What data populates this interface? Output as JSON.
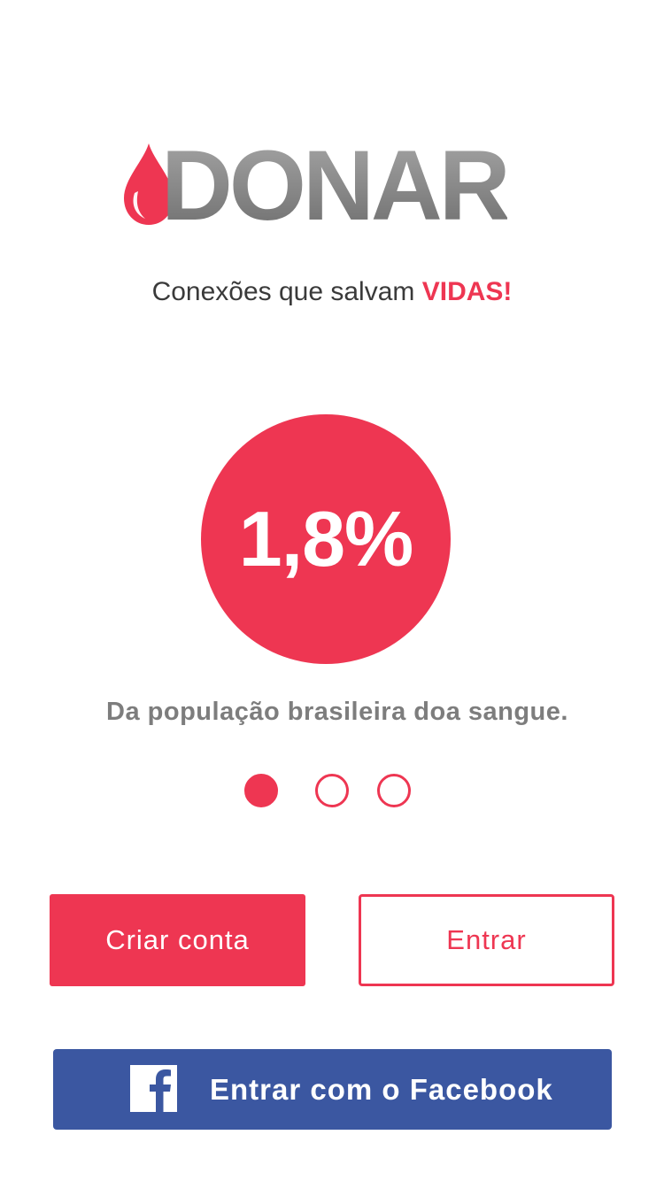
{
  "brand": {
    "name": "DONAR",
    "tagline_prefix": "Conexões que salvam ",
    "tagline_accent": "VIDAS!",
    "accent_color": "#ee3652",
    "facebook_color": "#3b57a1"
  },
  "onboarding": {
    "stat_value": "1,8%",
    "stat_caption": "Da população brasileira doa sangue.",
    "pages_total": 3,
    "active_page": 1
  },
  "actions": {
    "create_account_label": "Criar conta",
    "login_label": "Entrar",
    "facebook_label": "Entrar com o Facebook"
  },
  "icons": {
    "logo": "blood-drop-icon",
    "facebook": "facebook-icon"
  }
}
